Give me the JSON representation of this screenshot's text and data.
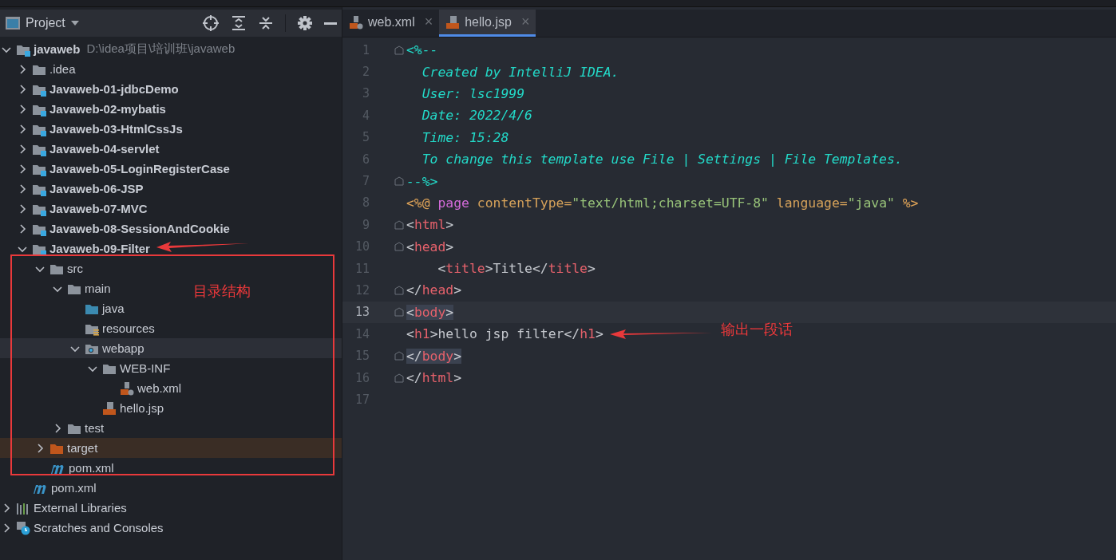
{
  "project_panel": {
    "title": "Project",
    "tree": [
      {
        "label": "javaweb",
        "path": "D:\\idea项目\\培训班\\javaweb",
        "kind": "module",
        "bold": true,
        "expanded": true,
        "selected": false,
        "children": [
          {
            "label": ".idea",
            "kind": "folder",
            "bold": false,
            "expanded": false,
            "selected": false
          },
          {
            "label": "Javaweb-01-jdbcDemo",
            "kind": "module",
            "bold": true,
            "expanded": false,
            "selected": false
          },
          {
            "label": "Javaweb-02-mybatis",
            "kind": "module",
            "bold": true,
            "expanded": false,
            "selected": false
          },
          {
            "label": "Javaweb-03-HtmlCssJs",
            "kind": "module",
            "bold": true,
            "expanded": false,
            "selected": false
          },
          {
            "label": "Javaweb-04-servlet",
            "kind": "module",
            "bold": true,
            "expanded": false,
            "selected": false
          },
          {
            "label": "Javaweb-05-LoginRegisterCase",
            "kind": "module",
            "bold": true,
            "expanded": false,
            "selected": false
          },
          {
            "label": "Javaweb-06-JSP",
            "kind": "module",
            "bold": true,
            "expanded": false,
            "selected": false
          },
          {
            "label": "Javaweb-07-MVC",
            "kind": "module",
            "bold": true,
            "expanded": false,
            "selected": false
          },
          {
            "label": "Javaweb-08-SessionAndCookie",
            "kind": "module",
            "bold": true,
            "expanded": false,
            "selected": false
          },
          {
            "label": "Javaweb-09-Filter",
            "kind": "module",
            "bold": true,
            "expanded": true,
            "selected": false,
            "children": [
              {
                "label": "src",
                "kind": "folder",
                "bold": false,
                "expanded": true,
                "selected": false,
                "children": [
                  {
                    "label": "main",
                    "kind": "folder",
                    "bold": false,
                    "expanded": true,
                    "selected": false,
                    "children": [
                      {
                        "label": "java",
                        "kind": "source",
                        "bold": false,
                        "selected": false
                      },
                      {
                        "label": "resources",
                        "kind": "resources",
                        "bold": false,
                        "selected": false
                      },
                      {
                        "label": "webapp",
                        "kind": "web",
                        "bold": false,
                        "expanded": true,
                        "selected": true,
                        "children": [
                          {
                            "label": "WEB-INF",
                            "kind": "folder",
                            "bold": false,
                            "expanded": true,
                            "selected": false,
                            "children": [
                              {
                                "label": "web.xml",
                                "kind": "xml",
                                "bold": false,
                                "selected": false
                              }
                            ]
                          },
                          {
                            "label": "hello.jsp",
                            "kind": "jsp",
                            "bold": false,
                            "selected": false
                          }
                        ]
                      }
                    ]
                  },
                  {
                    "label": "test",
                    "kind": "folder",
                    "bold": false,
                    "expanded": false,
                    "selected": false
                  }
                ]
              },
              {
                "label": "target",
                "kind": "excluded",
                "bold": false,
                "expanded": false,
                "selected": false
              },
              {
                "label": "pom.xml",
                "kind": "pom",
                "bold": false,
                "selected": false
              }
            ]
          },
          {
            "label": "pom.xml",
            "kind": "pom",
            "bold": false,
            "selected": false
          }
        ]
      },
      {
        "label": "External Libraries",
        "kind": "libraries",
        "bold": false,
        "expanded": false,
        "selected": false
      },
      {
        "label": "Scratches and Consoles",
        "kind": "scratches",
        "bold": false,
        "expanded": false,
        "selected": false
      }
    ]
  },
  "tabs": [
    {
      "label": "web.xml",
      "kind": "xml",
      "close": "×",
      "selected": false
    },
    {
      "label": "hello.jsp",
      "kind": "jsp",
      "close": "×",
      "selected": true
    }
  ],
  "editor": {
    "lines": [
      {
        "number": "1",
        "fold": true,
        "current": false,
        "brace_match": false,
        "tokens": [
          {
            "text": "<%--",
            "kind": "comment"
          }
        ]
      },
      {
        "number": "2",
        "fold": false,
        "current": false,
        "brace_match": false,
        "tokens": [
          {
            "text": "  Created by IntelliJ IDEA.",
            "kind": "comment"
          }
        ]
      },
      {
        "number": "3",
        "fold": false,
        "current": false,
        "brace_match": false,
        "tokens": [
          {
            "text": "  User: lsc1999",
            "kind": "comment"
          }
        ]
      },
      {
        "number": "4",
        "fold": false,
        "current": false,
        "brace_match": false,
        "tokens": [
          {
            "text": "  Date: 2022/4/6",
            "kind": "comment"
          }
        ]
      },
      {
        "number": "5",
        "fold": false,
        "current": false,
        "brace_match": false,
        "tokens": [
          {
            "text": "  Time: 15:28",
            "kind": "comment"
          }
        ]
      },
      {
        "number": "6",
        "fold": false,
        "current": false,
        "brace_match": false,
        "tokens": [
          {
            "text": "  To change this template use File | Settings | File Templates.",
            "kind": "comment"
          }
        ]
      },
      {
        "number": "7",
        "fold": true,
        "current": false,
        "brace_match": false,
        "tokens": [
          {
            "text": "--%>",
            "kind": "comment"
          }
        ]
      },
      {
        "number": "8",
        "fold": false,
        "current": false,
        "brace_match": false,
        "tokens": [
          {
            "text": "<%@ ",
            "kind": "directive"
          },
          {
            "text": "page",
            "kind": "keyword"
          },
          {
            "text": " contentType=",
            "kind": "attr"
          },
          {
            "text": "\"text/html;charset=UTF-8\"",
            "kind": "string"
          },
          {
            "text": " language=",
            "kind": "attr"
          },
          {
            "text": "\"java\"",
            "kind": "string"
          },
          {
            "text": " %>",
            "kind": "directive"
          }
        ]
      },
      {
        "number": "9",
        "fold": true,
        "current": false,
        "brace_match": false,
        "tokens": [
          {
            "text": "<",
            "kind": "punct"
          },
          {
            "text": "html",
            "kind": "tag"
          },
          {
            "text": ">",
            "kind": "punct"
          }
        ]
      },
      {
        "number": "10",
        "fold": true,
        "current": false,
        "brace_match": false,
        "tokens": [
          {
            "text": "<",
            "kind": "punct"
          },
          {
            "text": "head",
            "kind": "tag"
          },
          {
            "text": ">",
            "kind": "punct"
          }
        ]
      },
      {
        "number": "11",
        "fold": false,
        "current": false,
        "brace_match": false,
        "tokens": [
          {
            "text": "    <",
            "kind": "punct"
          },
          {
            "text": "title",
            "kind": "tag"
          },
          {
            "text": ">Title</",
            "kind": "punct"
          },
          {
            "text": "title",
            "kind": "tag"
          },
          {
            "text": ">",
            "kind": "punct"
          }
        ]
      },
      {
        "number": "12",
        "fold": true,
        "current": false,
        "brace_match": false,
        "tokens": [
          {
            "text": "</",
            "kind": "punct"
          },
          {
            "text": "head",
            "kind": "tag"
          },
          {
            "text": ">",
            "kind": "punct"
          }
        ]
      },
      {
        "number": "13",
        "fold": true,
        "current": true,
        "brace_match": true,
        "tokens": [
          {
            "text": "<",
            "kind": "punct"
          },
          {
            "text": "body",
            "kind": "tag"
          },
          {
            "text": ">",
            "kind": "punct"
          }
        ]
      },
      {
        "number": "14",
        "fold": false,
        "current": false,
        "brace_match": false,
        "tokens": [
          {
            "text": "<",
            "kind": "punct"
          },
          {
            "text": "h1",
            "kind": "tag"
          },
          {
            "text": ">hello jsp filter</",
            "kind": "punct"
          },
          {
            "text": "h1",
            "kind": "tag"
          },
          {
            "text": ">",
            "kind": "punct"
          }
        ]
      },
      {
        "number": "15",
        "fold": true,
        "current": false,
        "brace_match": true,
        "tokens": [
          {
            "text": "</",
            "kind": "punct"
          },
          {
            "text": "body",
            "kind": "tag"
          },
          {
            "text": ">",
            "kind": "punct"
          }
        ]
      },
      {
        "number": "16",
        "fold": true,
        "current": false,
        "brace_match": false,
        "tokens": [
          {
            "text": "</",
            "kind": "punct"
          },
          {
            "text": "html",
            "kind": "tag"
          },
          {
            "text": ">",
            "kind": "punct"
          }
        ]
      },
      {
        "number": "17",
        "fold": false,
        "current": false,
        "brace_match": false
      }
    ]
  },
  "annotations": [
    {
      "text": "目录结构"
    },
    {
      "text": "输出一段话"
    }
  ]
}
